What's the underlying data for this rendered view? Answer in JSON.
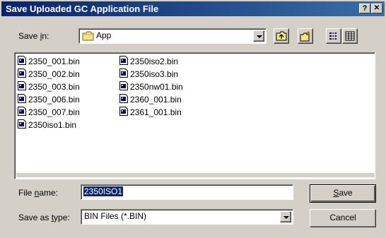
{
  "window": {
    "title": "Save Uploaded GC Application File",
    "help_label": "?",
    "close_label": "✕"
  },
  "save_in": {
    "label_pre": "Save ",
    "label_ul": "i",
    "label_post": "n:",
    "value": "App",
    "icons": [
      "folder-icon",
      "chevron-down-icon"
    ]
  },
  "toolbar": {
    "buttons": [
      "up-one-level",
      "create-new-folder",
      "list-view",
      "details-view"
    ]
  },
  "files": {
    "col1": [
      "2350_001.bin",
      "2350_002.bin",
      "2350_003.bin",
      "2350_006.bin",
      "2350_007.bin",
      "2350iso1.bin"
    ],
    "col2": [
      "2350iso2.bin",
      "2350iso3.bin",
      "2350nw01.bin",
      "2360_001.bin",
      "2361_001.bin"
    ]
  },
  "file_name": {
    "label_pre": "File ",
    "label_ul": "n",
    "label_post": "ame:",
    "value": "2350ISO1"
  },
  "save_as_type": {
    "label_pre": "Save as ",
    "label_ul": "t",
    "label_post": "ype:",
    "value": "BIN Files (*.BIN)"
  },
  "buttons": {
    "save_ul": "S",
    "save_post": "ave",
    "cancel": "Cancel"
  },
  "colors": {
    "title_start": "#0a246a",
    "title_end": "#3a6ea5",
    "face": "#d4d0c8",
    "selection": "#0a246a"
  }
}
